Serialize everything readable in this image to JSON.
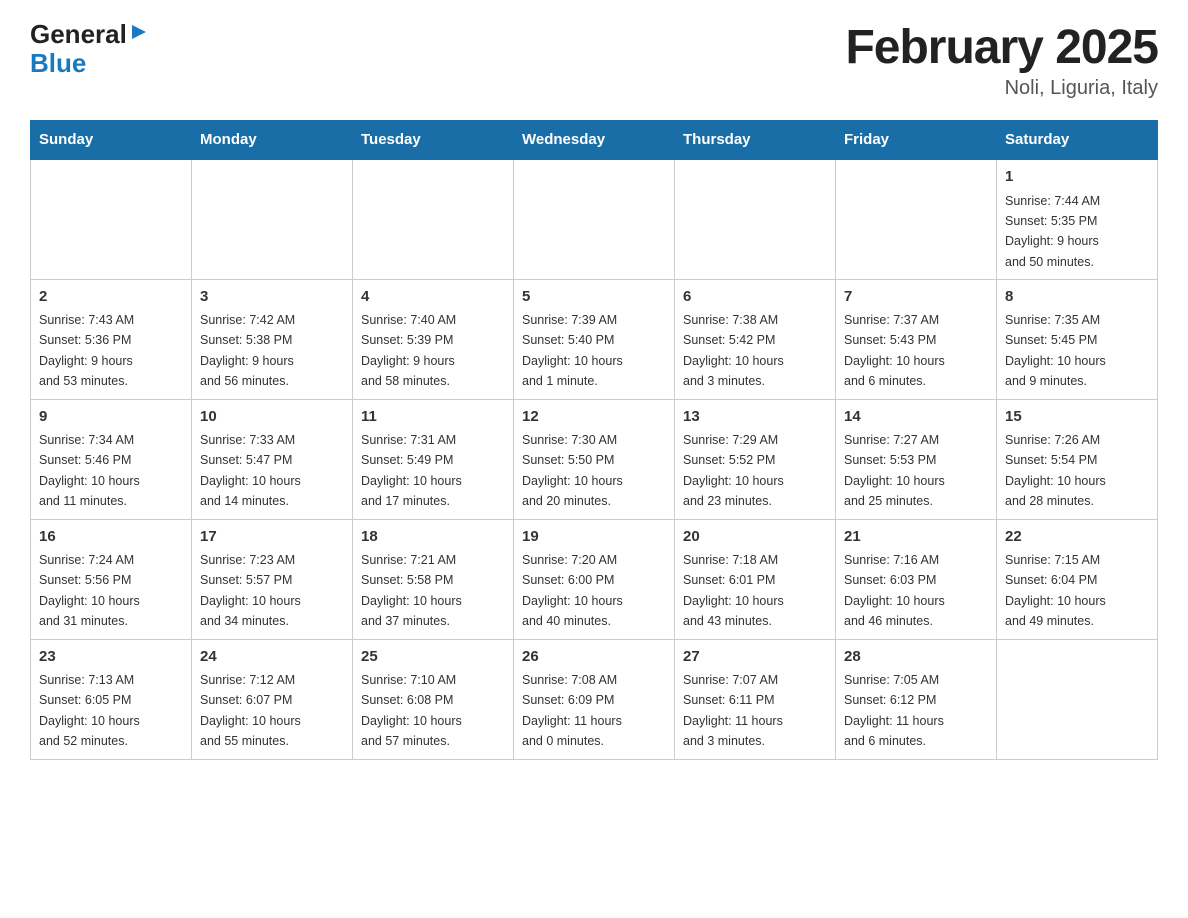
{
  "logo": {
    "general": "General",
    "blue": "Blue"
  },
  "title": {
    "month_year": "February 2025",
    "location": "Noli, Liguria, Italy"
  },
  "days_of_week": [
    "Sunday",
    "Monday",
    "Tuesday",
    "Wednesday",
    "Thursday",
    "Friday",
    "Saturday"
  ],
  "weeks": [
    [
      {
        "day": "",
        "info": ""
      },
      {
        "day": "",
        "info": ""
      },
      {
        "day": "",
        "info": ""
      },
      {
        "day": "",
        "info": ""
      },
      {
        "day": "",
        "info": ""
      },
      {
        "day": "",
        "info": ""
      },
      {
        "day": "1",
        "info": "Sunrise: 7:44 AM\nSunset: 5:35 PM\nDaylight: 9 hours\nand 50 minutes."
      }
    ],
    [
      {
        "day": "2",
        "info": "Sunrise: 7:43 AM\nSunset: 5:36 PM\nDaylight: 9 hours\nand 53 minutes."
      },
      {
        "day": "3",
        "info": "Sunrise: 7:42 AM\nSunset: 5:38 PM\nDaylight: 9 hours\nand 56 minutes."
      },
      {
        "day": "4",
        "info": "Sunrise: 7:40 AM\nSunset: 5:39 PM\nDaylight: 9 hours\nand 58 minutes."
      },
      {
        "day": "5",
        "info": "Sunrise: 7:39 AM\nSunset: 5:40 PM\nDaylight: 10 hours\nand 1 minute."
      },
      {
        "day": "6",
        "info": "Sunrise: 7:38 AM\nSunset: 5:42 PM\nDaylight: 10 hours\nand 3 minutes."
      },
      {
        "day": "7",
        "info": "Sunrise: 7:37 AM\nSunset: 5:43 PM\nDaylight: 10 hours\nand 6 minutes."
      },
      {
        "day": "8",
        "info": "Sunrise: 7:35 AM\nSunset: 5:45 PM\nDaylight: 10 hours\nand 9 minutes."
      }
    ],
    [
      {
        "day": "9",
        "info": "Sunrise: 7:34 AM\nSunset: 5:46 PM\nDaylight: 10 hours\nand 11 minutes."
      },
      {
        "day": "10",
        "info": "Sunrise: 7:33 AM\nSunset: 5:47 PM\nDaylight: 10 hours\nand 14 minutes."
      },
      {
        "day": "11",
        "info": "Sunrise: 7:31 AM\nSunset: 5:49 PM\nDaylight: 10 hours\nand 17 minutes."
      },
      {
        "day": "12",
        "info": "Sunrise: 7:30 AM\nSunset: 5:50 PM\nDaylight: 10 hours\nand 20 minutes."
      },
      {
        "day": "13",
        "info": "Sunrise: 7:29 AM\nSunset: 5:52 PM\nDaylight: 10 hours\nand 23 minutes."
      },
      {
        "day": "14",
        "info": "Sunrise: 7:27 AM\nSunset: 5:53 PM\nDaylight: 10 hours\nand 25 minutes."
      },
      {
        "day": "15",
        "info": "Sunrise: 7:26 AM\nSunset: 5:54 PM\nDaylight: 10 hours\nand 28 minutes."
      }
    ],
    [
      {
        "day": "16",
        "info": "Sunrise: 7:24 AM\nSunset: 5:56 PM\nDaylight: 10 hours\nand 31 minutes."
      },
      {
        "day": "17",
        "info": "Sunrise: 7:23 AM\nSunset: 5:57 PM\nDaylight: 10 hours\nand 34 minutes."
      },
      {
        "day": "18",
        "info": "Sunrise: 7:21 AM\nSunset: 5:58 PM\nDaylight: 10 hours\nand 37 minutes."
      },
      {
        "day": "19",
        "info": "Sunrise: 7:20 AM\nSunset: 6:00 PM\nDaylight: 10 hours\nand 40 minutes."
      },
      {
        "day": "20",
        "info": "Sunrise: 7:18 AM\nSunset: 6:01 PM\nDaylight: 10 hours\nand 43 minutes."
      },
      {
        "day": "21",
        "info": "Sunrise: 7:16 AM\nSunset: 6:03 PM\nDaylight: 10 hours\nand 46 minutes."
      },
      {
        "day": "22",
        "info": "Sunrise: 7:15 AM\nSunset: 6:04 PM\nDaylight: 10 hours\nand 49 minutes."
      }
    ],
    [
      {
        "day": "23",
        "info": "Sunrise: 7:13 AM\nSunset: 6:05 PM\nDaylight: 10 hours\nand 52 minutes."
      },
      {
        "day": "24",
        "info": "Sunrise: 7:12 AM\nSunset: 6:07 PM\nDaylight: 10 hours\nand 55 minutes."
      },
      {
        "day": "25",
        "info": "Sunrise: 7:10 AM\nSunset: 6:08 PM\nDaylight: 10 hours\nand 57 minutes."
      },
      {
        "day": "26",
        "info": "Sunrise: 7:08 AM\nSunset: 6:09 PM\nDaylight: 11 hours\nand 0 minutes."
      },
      {
        "day": "27",
        "info": "Sunrise: 7:07 AM\nSunset: 6:11 PM\nDaylight: 11 hours\nand 3 minutes."
      },
      {
        "day": "28",
        "info": "Sunrise: 7:05 AM\nSunset: 6:12 PM\nDaylight: 11 hours\nand 6 minutes."
      },
      {
        "day": "",
        "info": ""
      }
    ]
  ]
}
